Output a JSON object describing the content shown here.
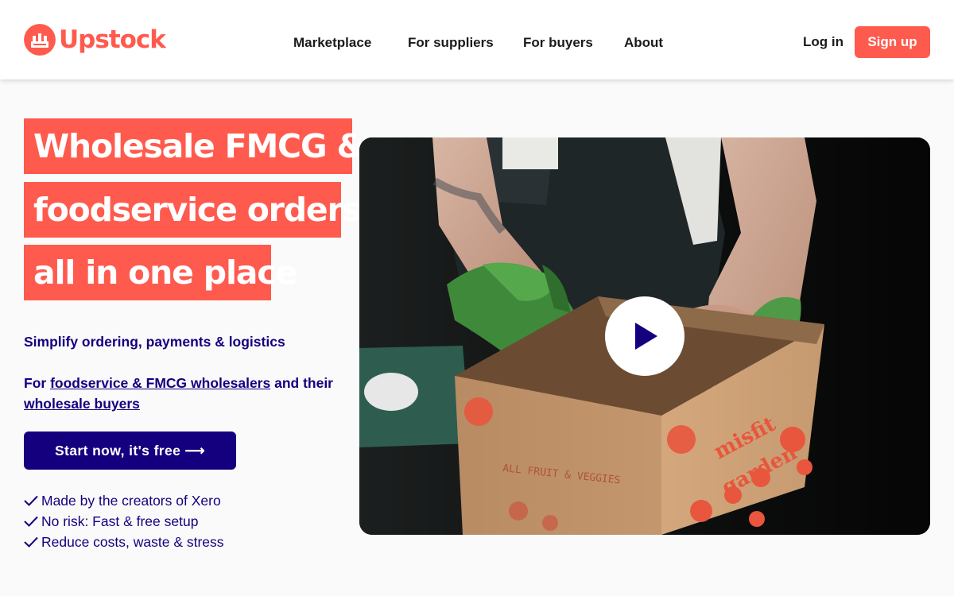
{
  "header": {
    "logo_text": "Upstock",
    "nav": [
      {
        "label": "Marketplace"
      },
      {
        "label": "For suppliers"
      },
      {
        "label": "For buyers"
      },
      {
        "label": "About"
      }
    ],
    "login_label": "Log in",
    "signup_label": "Sign up"
  },
  "hero": {
    "headline": [
      "Wholesale FMCG &",
      "foodservice orders:",
      "all in one place"
    ],
    "tagline": "Simplify ordering, payments & logistics",
    "audience": {
      "prefix": "For ",
      "link1": "foodservice & FMCG wholesalers",
      "middle": " and their ",
      "link2": "wholesale buyers"
    },
    "cta_label": "Start now, it's free ⟶",
    "benefits": [
      "Made by the creators of Xero",
      "No risk: Fast & free setup",
      "Reduce costs, waste & stress"
    ]
  },
  "video": {
    "box_text": "misfit garden",
    "box_side_text": "ALL FRUIT & VEGGIES",
    "play_icon": "play-icon"
  },
  "colors": {
    "brand": "#ff5a4e",
    "navy": "#14007f",
    "background": "#fafafa"
  }
}
